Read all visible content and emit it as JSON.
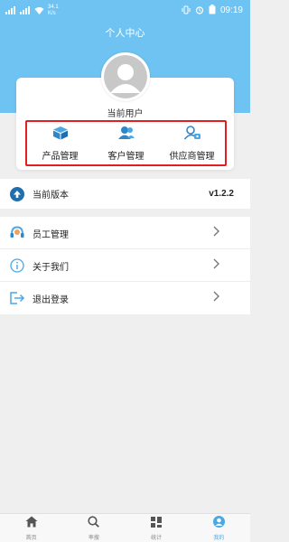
{
  "statusbar": {
    "left_icons": [
      "sim1-signal-icon",
      "sim2-signal-icon",
      "wifi-icon"
    ],
    "speed": "34.1",
    "speed_unit": "K/s",
    "right_icons": [
      "vibrate-icon",
      "alarm-icon",
      "battery-icon"
    ],
    "time": "09:19"
  },
  "page": {
    "title": "个人中心"
  },
  "profile": {
    "username": "当前用户"
  },
  "quick_actions": [
    {
      "label": "产品管理",
      "icon": "product-box-icon"
    },
    {
      "label": "客户管理",
      "icon": "customers-icon"
    },
    {
      "label": "供应商管理",
      "icon": "supplier-icon"
    }
  ],
  "version": {
    "label": "当前版本",
    "value": "v1.2.2",
    "icon": "upload-arrow-icon"
  },
  "menu": [
    {
      "label": "员工管理",
      "icon": "headset-icon"
    },
    {
      "label": "关于我们",
      "icon": "info-icon"
    },
    {
      "label": "退出登录",
      "icon": "logout-icon"
    }
  ],
  "tabbar": [
    {
      "label": "首页",
      "icon": "home-icon"
    },
    {
      "label": "率搜",
      "icon": "search-icon"
    },
    {
      "label": "统计",
      "icon": "stats-icon"
    },
    {
      "label": "我的",
      "icon": "user-icon"
    }
  ],
  "colors": {
    "header": "#6fc3f2",
    "accent": "#4aa8e6",
    "highlight_box": "#e02020"
  }
}
